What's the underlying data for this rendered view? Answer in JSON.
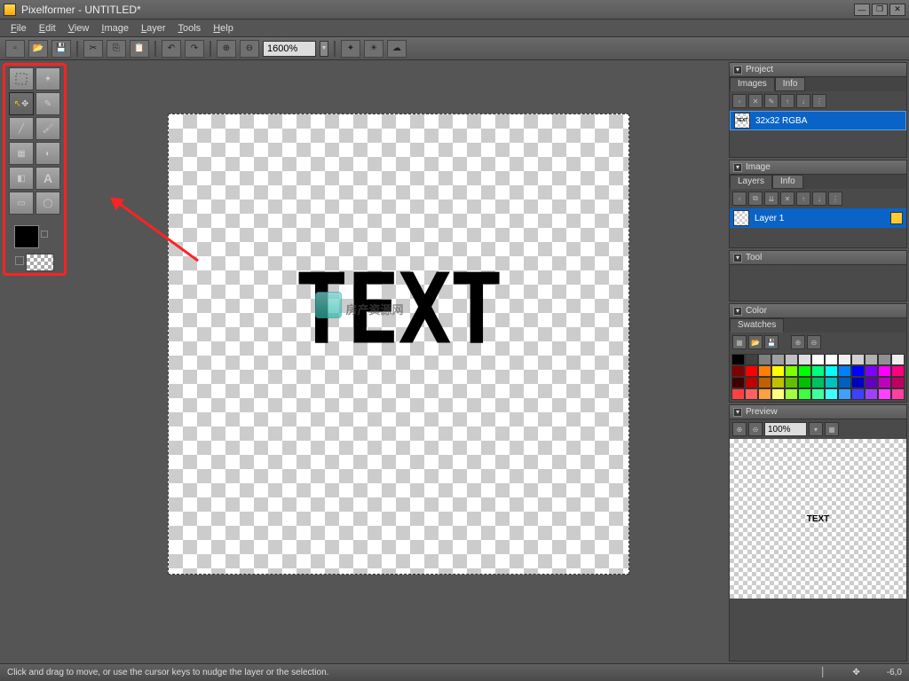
{
  "titlebar": {
    "app": "Pixelformer",
    "doc": "UNTITLED*"
  },
  "menubar": [
    "File",
    "Edit",
    "View",
    "Image",
    "Layer",
    "Tools",
    "Help"
  ],
  "toolbar": {
    "zoom": "1600%"
  },
  "panels": {
    "project": {
      "title": "Project",
      "tabs": [
        "Images",
        "Info"
      ],
      "item": "32x32 RGBA",
      "thumb_text": "TEXT"
    },
    "image": {
      "title": "Image",
      "tabs": [
        "Layers",
        "Info"
      ],
      "layer": "Layer 1"
    },
    "tool": {
      "title": "Tool"
    },
    "color": {
      "title": "Color",
      "tabs": [
        "Swatches"
      ]
    },
    "preview": {
      "title": "Preview",
      "zoom": "100%",
      "text": "TEXT"
    }
  },
  "canvas": {
    "text": "TEXT",
    "watermark": "房产资源网"
  },
  "statusbar": {
    "hint": "Click and drag to move, or use the cursor keys to nudge the layer or the selection.",
    "coord": "-6,0"
  },
  "swatch_colors": [
    "#000000",
    "#404040",
    "#808080",
    "#a0a0a0",
    "#c0c0c0",
    "#e0e0e0",
    "#ffffff",
    "#ffffff",
    "#f0f0f0",
    "#d0d0d0",
    "#b0b0b0",
    "#909090",
    "#eeeeee",
    "#800000",
    "#ff0000",
    "#ff8000",
    "#ffff00",
    "#80ff00",
    "#00ff00",
    "#00ff80",
    "#00ffff",
    "#0080ff",
    "#0000ff",
    "#8000ff",
    "#ff00ff",
    "#ff0080",
    "#400000",
    "#c00000",
    "#c06000",
    "#c0c000",
    "#60c000",
    "#00c000",
    "#00c060",
    "#00c0c0",
    "#0060c0",
    "#0000c0",
    "#6000c0",
    "#c000c0",
    "#c00060",
    "#ff4040",
    "#ff6060",
    "#ffa040",
    "#ffff80",
    "#a0ff40",
    "#40ff40",
    "#40ffa0",
    "#40ffff",
    "#40a0ff",
    "#4040ff",
    "#a040ff",
    "#ff40ff",
    "#ff40a0"
  ]
}
